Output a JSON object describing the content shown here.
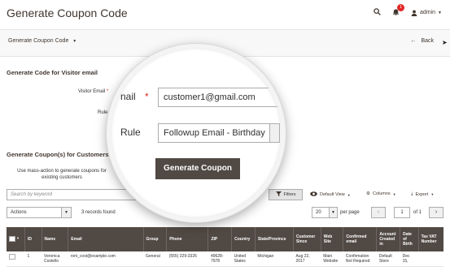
{
  "header": {
    "title": "Generate Coupon Code",
    "notification_count": "1",
    "user": "admin",
    "icons": [
      "search-icon",
      "bell-icon",
      "user-icon"
    ]
  },
  "actionbar": {
    "split_button": "Generate Coupon Code",
    "back_button": "Back"
  },
  "visitor_section": {
    "title": "Generate Code for Visitor email",
    "email_label": "Visitor Email",
    "rule_label": "Rule"
  },
  "magnifier": {
    "email_label_partial": "nail",
    "email_value": "customer1@gmail.com",
    "rule_label": "Rule",
    "rule_value": "Followup Email - Birthday",
    "button": "Generate Coupon"
  },
  "customers_section": {
    "title": "Generate Coupon(s) for Customers",
    "note": "Use mass-action to generate coupons for existing customers"
  },
  "grid_toolbar": {
    "search_placeholder": "Search by keyword",
    "filters": "Filters",
    "default_view": "Default View",
    "columns": "Columns",
    "export": "Export",
    "actions": "Actions",
    "records": "3 records found",
    "per_page_value": "20",
    "per_page_label": "per page",
    "page": "1",
    "of_pages": "of 1"
  },
  "table": {
    "columns": [
      "ID",
      "Name",
      "Email",
      "Group",
      "Phone",
      "ZIP",
      "Country",
      "State/Province",
      "Customer Since",
      "Web Site",
      "Confirmed email",
      "Account Created in",
      "Date of Birth",
      "Tax VAT Number"
    ],
    "rows": [
      {
        "id": "1",
        "name": "Veronica Costello",
        "email": "roni_cost@example.com",
        "group": "General",
        "phone": "(555) 229-3326",
        "zip": "49628-7978",
        "country": "United States",
        "state": "Michigan",
        "since": "Aug 22, 2017",
        "website": "Main Website",
        "confirmed": "Confirmation Not Required",
        "created_in": "Default Store",
        "dob": "Dec 15,",
        "taxvat": ""
      }
    ]
  },
  "colors": {
    "accent": "#514943",
    "required": "#e22626",
    "header_row": "#514943"
  }
}
